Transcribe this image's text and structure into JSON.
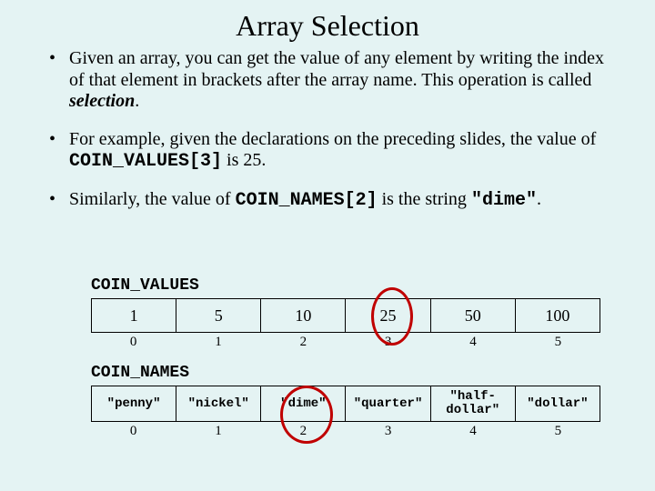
{
  "title": "Array Selection",
  "bullets": {
    "b1_a": "Given an array, you can get the value of any element by writing the index of that element in brackets after the array name.  This operation is called ",
    "b1_sel": "selection",
    "b1_b": ".",
    "b2_a": "For example, given the declarations on the preceding slides, the value of ",
    "b2_code": "COIN_VALUES[3]",
    "b2_b": " is 25.",
    "b3_a": "Similarly, the value of ",
    "b3_code": "COIN_NAMES[2]",
    "b3_b": " is the string ",
    "b3_code2": "\"dime\"",
    "b3_c": "."
  },
  "labels": {
    "coin_values": "COIN_VALUES",
    "coin_names": "COIN_NAMES"
  },
  "coin_values": {
    "v0": "1",
    "v1": "5",
    "v2": "10",
    "v3": "25",
    "v4": "50",
    "v5": "100"
  },
  "coin_names": {
    "n0": "\"penny\"",
    "n1": "\"nickel\"",
    "n2": "\"dime\"",
    "n3": "\"quarter\"",
    "n4": "\"half-\ndollar\"",
    "n5": "\"dollar\""
  },
  "idx": {
    "i0": "0",
    "i1": "1",
    "i2": "2",
    "i3": "3",
    "i4": "4",
    "i5": "5"
  },
  "chart_data": [
    {
      "type": "table",
      "title": "COIN_VALUES",
      "categories": [
        0,
        1,
        2,
        3,
        4,
        5
      ],
      "values": [
        1,
        5,
        10,
        25,
        50,
        100
      ],
      "highlight_index": 3
    },
    {
      "type": "table",
      "title": "COIN_NAMES",
      "categories": [
        0,
        1,
        2,
        3,
        4,
        5
      ],
      "values": [
        "\"penny\"",
        "\"nickel\"",
        "\"dime\"",
        "\"quarter\"",
        "\"half-dollar\"",
        "\"dollar\""
      ],
      "highlight_index": 2
    }
  ]
}
